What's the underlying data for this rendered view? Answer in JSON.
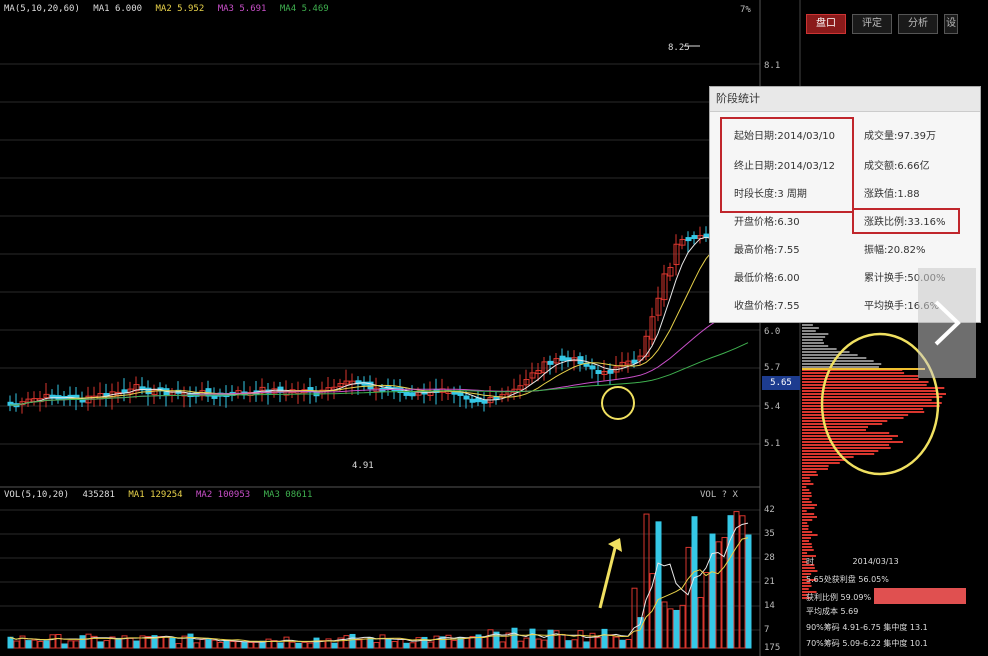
{
  "topbar": {
    "ma": "MA(5,10,20,60)",
    "ma5": "MA1 6.000",
    "ma10": "MA2 5.952",
    "ma20": "MA3 5.691",
    "ma60": "MA4 5.469",
    "right_label": "7%"
  },
  "volbar": {
    "vol": "VOL(5,10,20)",
    "v1": "435281",
    "v2": "MA1 129254",
    "v3": "MA2 100953",
    "v4": "MA3 08611",
    "right": "VOL ? X"
  },
  "annotations": {
    "high": "8.25",
    "low": "4.91"
  },
  "price_axis": [
    "8.1",
    "6.0",
    "5.7",
    "5.4",
    "5.1"
  ],
  "vol_axis": [
    "42",
    "35",
    "28",
    "21",
    "14",
    "7",
    "175"
  ],
  "current_price": "5.65",
  "tabs": [
    {
      "label": "盘口",
      "active": true
    },
    {
      "label": "评定",
      "active": false
    },
    {
      "label": "分析",
      "active": false
    },
    {
      "label": "设",
      "active": false
    }
  ],
  "popup": {
    "title": "阶段统计",
    "left": [
      "起始日期:2014/03/10",
      "终止日期:2014/03/12",
      "时段长度:3 周期",
      "开盘价格:6.30",
      "最高价格:7.55",
      "最低价格:6.00",
      "收盘价格:7.55"
    ],
    "right": [
      "成交量:97.39万",
      "成交额:6.66亿",
      "涨跌值:1.88",
      "涨跌比例:33.16%",
      "振幅:20.82%",
      "累计换手:50.00%",
      "平均换手:16.6%"
    ]
  },
  "bottom_panel": {
    "l1a": "时",
    "l1b": "2014/03/13",
    "l2": "5.65处获利盘 56.05%",
    "l3": "获利比例 59.09%",
    "l4": "平均成本 5.69",
    "l5": "90%筹码 4.91-6.75 集中度 13.1",
    "l6": "70%筹码 5.09-6.22 集中度 10.1"
  },
  "colors": {
    "up": "#d9362e",
    "down": "#35c8e6",
    "ma1": "#e8e8e8",
    "ma2": "#e8d24a",
    "ma3": "#c84fc8",
    "ma4": "#3fb04f",
    "redbox": "#c0262c",
    "circle": "#f0e060"
  }
}
